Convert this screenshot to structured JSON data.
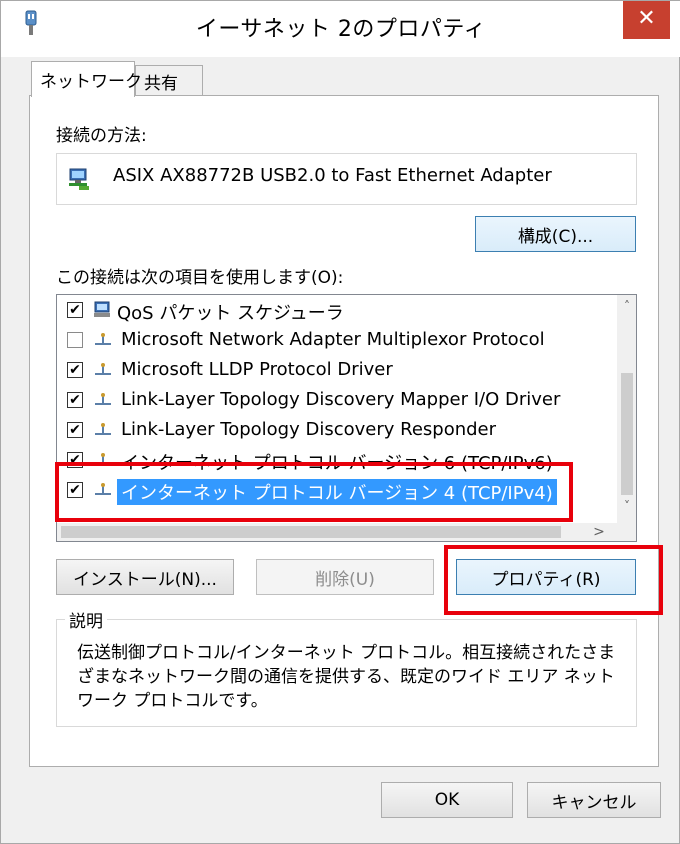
{
  "window": {
    "title": "イーサネット 2のプロパティ",
    "close_glyph": "✕"
  },
  "tabs": [
    {
      "label": "ネットワーク",
      "active": true
    },
    {
      "label": "共有",
      "active": false
    }
  ],
  "connection": {
    "label": "接続の方法:",
    "adapter_name": "ASIX AX88772B USB2.0 to Fast Ethernet Adapter",
    "adapter_icon": "network-adapter-icon",
    "configure_button": "構成(C)..."
  },
  "items_section": {
    "label": "この接続は次の項目を使用します(O):",
    "items": [
      {
        "label": "QoS パケット スケジューラ",
        "checked": true,
        "icon": "qos-scheduler-icon",
        "selected": false
      },
      {
        "label": "Microsoft Network Adapter Multiplexor Protocol",
        "checked": false,
        "icon": "protocol-icon",
        "selected": false
      },
      {
        "label": "Microsoft LLDP Protocol Driver",
        "checked": true,
        "icon": "protocol-icon",
        "selected": false
      },
      {
        "label": "Link-Layer Topology Discovery Mapper I/O Driver",
        "checked": true,
        "icon": "protocol-icon",
        "selected": false
      },
      {
        "label": "Link-Layer Topology Discovery Responder",
        "checked": true,
        "icon": "protocol-icon",
        "selected": false
      },
      {
        "label": "インターネット プロトコル バージョン 6 (TCP/IPv6)",
        "checked": true,
        "icon": "protocol-icon",
        "selected": false
      },
      {
        "label": "インターネット プロトコル バージョン 4 (TCP/IPv4)",
        "checked": true,
        "icon": "protocol-icon",
        "selected": true
      }
    ],
    "scroll_up": "˄",
    "scroll_down": "˅",
    "scroll_left": "<",
    "scroll_right": ">"
  },
  "buttons": {
    "install": "インストール(N)...",
    "remove": "削除(U)",
    "properties": "プロパティ(R)"
  },
  "description": {
    "title": "説明",
    "text": "伝送制御プロトコル/インターネット プロトコル。相互接続されたさまざまなネットワーク間の通信を提供する、既定のワイド エリア ネットワーク プロトコルです。"
  },
  "footer": {
    "ok": "OK",
    "cancel": "キャンセル"
  },
  "colors": {
    "highlight_annotation": "#e8000b",
    "selection": "#3399ff",
    "close_button": "#c7402f"
  }
}
